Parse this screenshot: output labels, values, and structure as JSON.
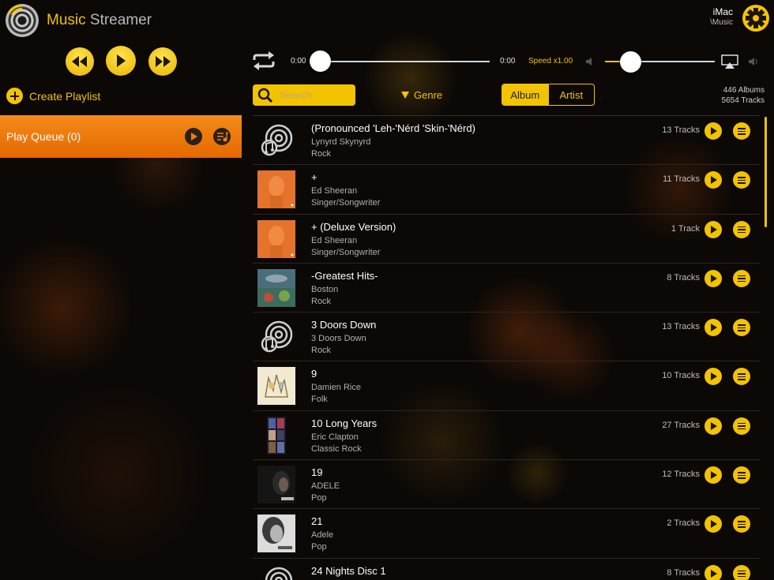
{
  "app": {
    "title_part1": "Music",
    "title_part2": "Streamer"
  },
  "device": {
    "name": "iMac",
    "path": "\\Music"
  },
  "player": {
    "time_elapsed": "0:00",
    "time_total": "0:00",
    "speed": "Speed x1.00",
    "progress": 0,
    "volume": 0.23
  },
  "sidebar": {
    "create_playlist": "Create Playlist",
    "play_queue": "Play Queue (0)"
  },
  "toolbar": {
    "search_placeholder": "Search",
    "genre": "Genre",
    "tab_album": "Album",
    "tab_artist": "Artist",
    "albums_count": "446 Albums",
    "tracks_count": "5654 Tracks"
  },
  "colors": {
    "accent": "#f2c300",
    "queue": "#f07d10",
    "background": "#0b0806"
  },
  "albums": [
    {
      "title": "(Pronounced 'Leh-'Nérd 'Skin-'Nérd)",
      "artist": "Lynyrd Skynyrd",
      "genre": "Rock",
      "tracks": "13 Tracks",
      "art": "placeholder-disc"
    },
    {
      "title": "+",
      "artist": "Ed Sheeran",
      "genre": "Singer/Songwriter",
      "tracks": "11 Tracks",
      "art": "orange-portrait"
    },
    {
      "title": "+ (Deluxe Version)",
      "artist": "Ed Sheeran",
      "genre": "Singer/Songwriter",
      "tracks": "1 Track",
      "art": "orange-portrait"
    },
    {
      "title": "-Greatest Hits-",
      "artist": "Boston",
      "genre": "Rock",
      "tracks": "8 Tracks",
      "art": "spaceship"
    },
    {
      "title": "3 Doors Down",
      "artist": "3 Doors Down",
      "genre": "Rock",
      "tracks": "13 Tracks",
      "art": "placeholder-disc"
    },
    {
      "title": "9",
      "artist": "Damien Rice",
      "genre": "Folk",
      "tracks": "10 Tracks",
      "art": "sketch"
    },
    {
      "title": "10 Long Years",
      "artist": "Eric Clapton",
      "genre": "Classic Rock",
      "tracks": "27 Tracks",
      "art": "photo-strip"
    },
    {
      "title": "19",
      "artist": "ADELE",
      "genre": "Pop",
      "tracks": "12 Tracks",
      "art": "dark-portrait"
    },
    {
      "title": "21",
      "artist": "Adele",
      "genre": "Pop",
      "tracks": "2 Tracks",
      "art": "bw-portrait"
    },
    {
      "title": "24 Nights Disc 1",
      "artist": "",
      "genre": "",
      "tracks": "8 Tracks",
      "art": "placeholder-disc"
    }
  ]
}
